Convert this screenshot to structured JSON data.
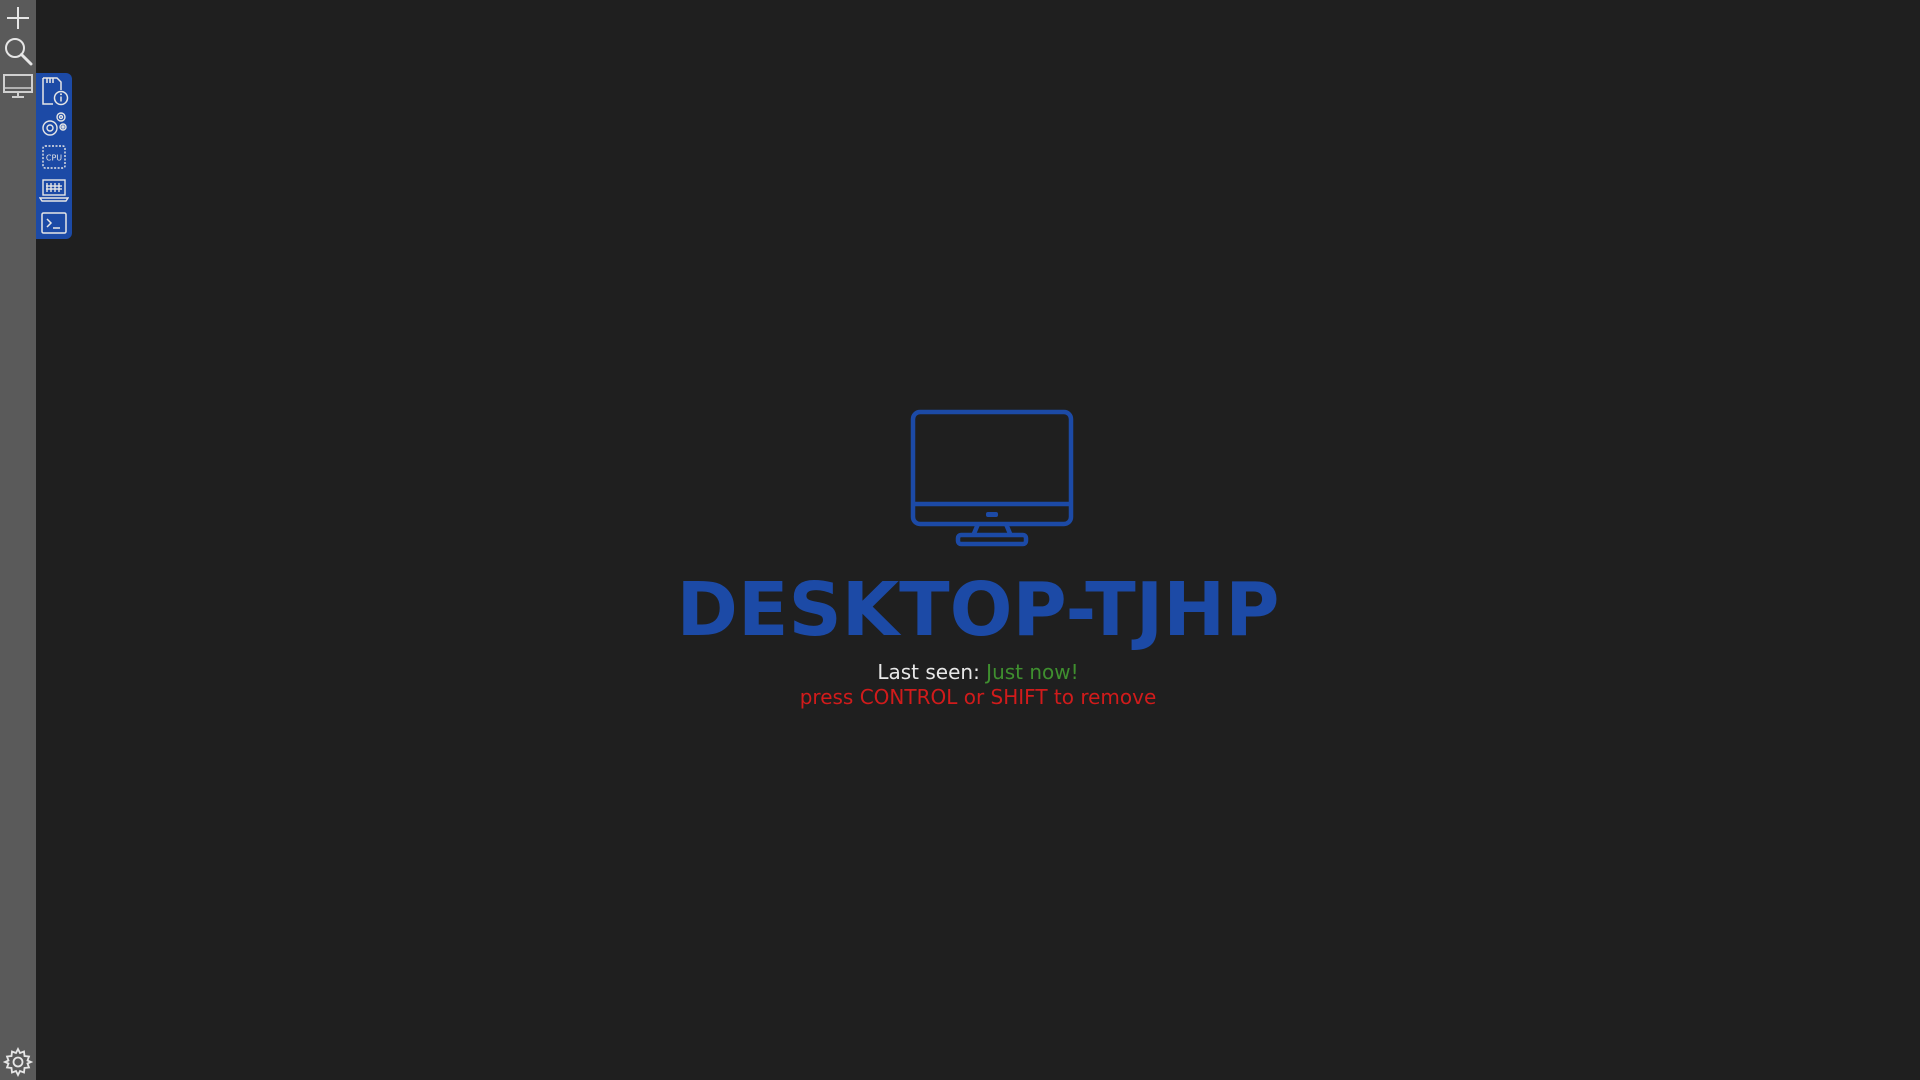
{
  "sidebar": {
    "items": [
      {
        "name": "add",
        "icon": "plus-icon"
      },
      {
        "name": "search",
        "icon": "search-icon"
      },
      {
        "name": "devices",
        "icon": "monitor-icon"
      }
    ],
    "footer": {
      "name": "settings",
      "icon": "gear-icon"
    }
  },
  "flyout": {
    "items": [
      {
        "name": "system-info",
        "icon": "sd-card-info-icon"
      },
      {
        "name": "services",
        "icon": "gears-icon"
      },
      {
        "name": "processes",
        "icon": "cpu-icon"
      },
      {
        "name": "remote-desktop",
        "icon": "laptop-icon"
      },
      {
        "name": "terminal",
        "icon": "terminal-icon"
      }
    ]
  },
  "device": {
    "icon": "monitor-icon",
    "hostname": "DESKTOP-TJHP",
    "last_seen_label": "Last seen: ",
    "last_seen_value": "Just now!",
    "remove_hint": "press CONTROL or SHIFT to remove"
  },
  "colors": {
    "background": "#1f1f1f",
    "sidebar": "#5a5a5a",
    "accent": "#1c4aa6",
    "status_online": "#3f8f2f",
    "warning": "#d11b1b"
  }
}
